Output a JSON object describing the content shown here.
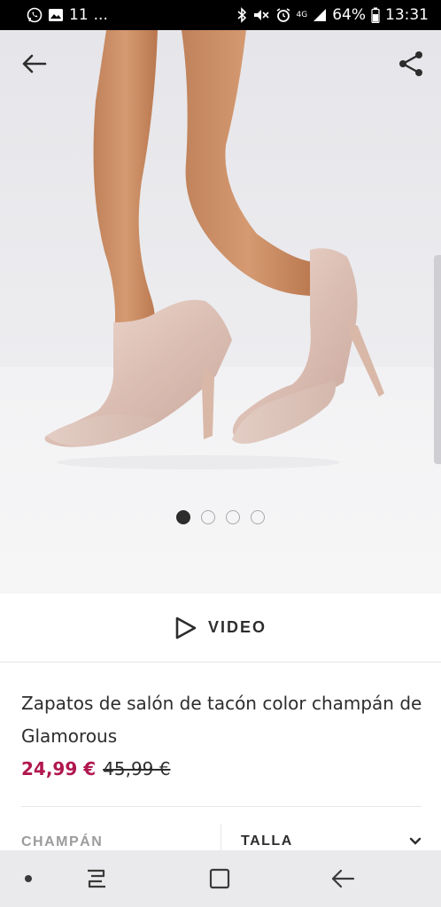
{
  "status_bar": {
    "notification_count": "11",
    "ellipsis": "...",
    "network": "4G",
    "battery": "64%",
    "time": "13:31"
  },
  "gallery": {
    "image_count": 4,
    "active_image": 1
  },
  "video": {
    "label": "VIDEO"
  },
  "product": {
    "title": "Zapatos de salón de tacón color champán de Glamorous",
    "price_current": "24,99 €",
    "price_original": "45,99 €"
  },
  "selectors": {
    "colour_label": "CHAMPÁN",
    "size_label": "TALLA"
  },
  "colors": {
    "price_accent": "#b1174f",
    "text": "#2d2d2d",
    "muted": "#9c9c9c"
  }
}
